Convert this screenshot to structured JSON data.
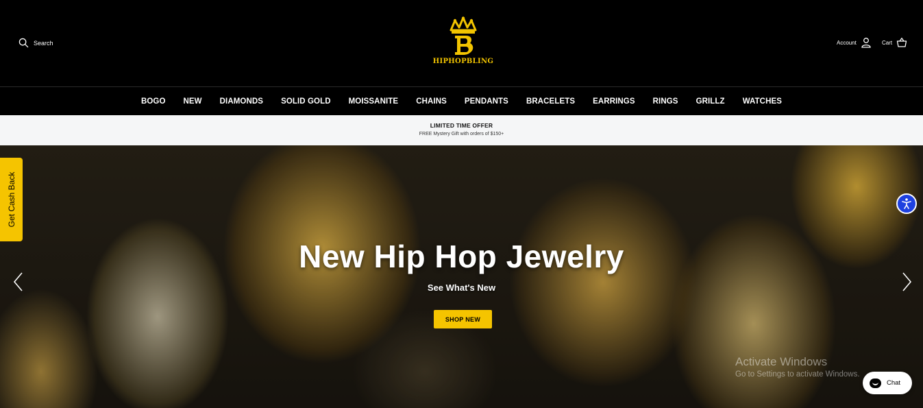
{
  "header": {
    "search_label": "Search",
    "logo_text": "HIPHOPBLING",
    "account_label": "Account",
    "cart_label": "Cart"
  },
  "nav": {
    "items": [
      "BOGO",
      "NEW",
      "DIAMONDS",
      "SOLID GOLD",
      "MOISSANITE",
      "CHAINS",
      "PENDANTS",
      "BRACELETS",
      "EARRINGS",
      "RINGS",
      "GRILLZ",
      "WATCHES"
    ]
  },
  "promo": {
    "title": "LIMITED TIME OFFER",
    "subtitle": "FREE Mystery Gift with orders of $150+"
  },
  "hero": {
    "title": "New Hip Hop Jewelry",
    "subtitle": "See What's New",
    "button": "SHOP NEW"
  },
  "cashback": {
    "label": "Get Cash Back"
  },
  "watermark": {
    "title": "Activate Windows",
    "subtitle": "Go to Settings to activate Windows."
  },
  "chat": {
    "label": "Chat"
  },
  "colors": {
    "accent": "#f5c400",
    "header_bg": "#000000",
    "promo_bg": "#f5f6f7",
    "a11y_blue": "#1e41e0"
  },
  "icons": {
    "search": "search-icon",
    "account": "user-icon",
    "cart": "basket-icon",
    "accessibility": "accessibility-icon",
    "chat": "chat-icon"
  }
}
